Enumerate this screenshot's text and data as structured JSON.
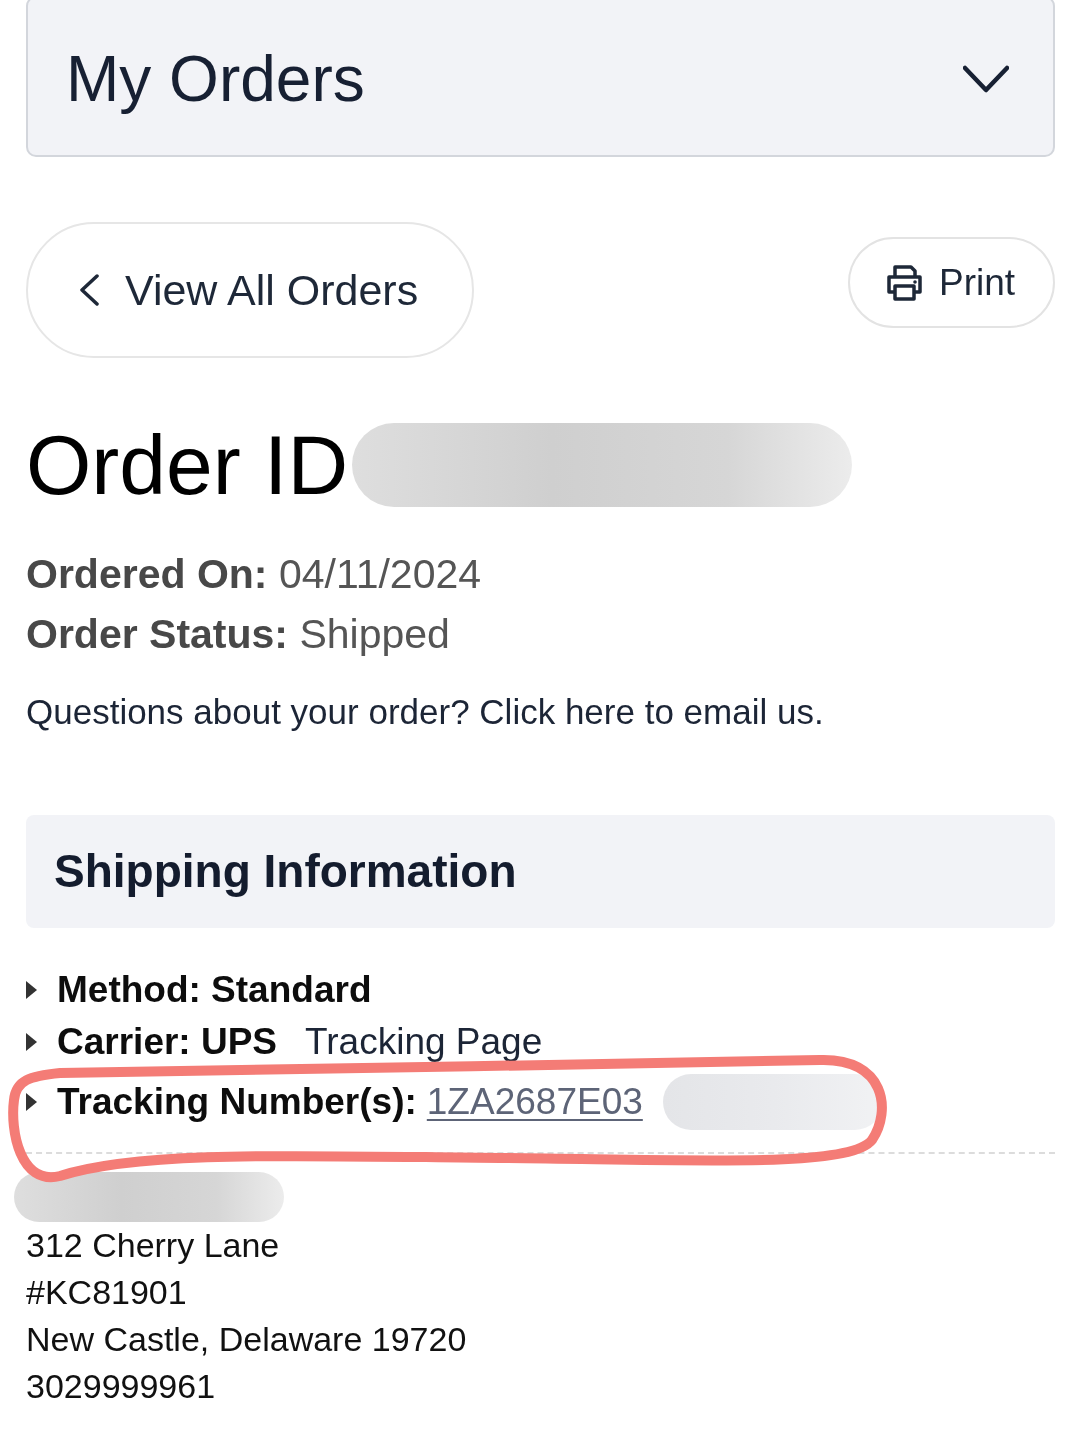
{
  "header_dropdown": {
    "label": "My Orders",
    "expanded": false
  },
  "actions": {
    "back": "View All Orders",
    "print": "Print"
  },
  "order": {
    "title": "Order ID",
    "details": [
      {
        "label": "Ordered On:",
        "value": "04/11/2024"
      },
      {
        "label": "Order Status:",
        "value": "Shipped"
      }
    ],
    "contact": "Questions about your order? Click here to email us."
  },
  "shipping": {
    "title": "Shipping Information",
    "items": [
      {
        "kind": "text",
        "text": "Method: Standard"
      },
      {
        "kind": "link",
        "text": "Carrier: UPS",
        "link": "Tracking Page"
      },
      {
        "kind": "tracking",
        "text": "Tracking Number(s):",
        "link": "1ZA2687E03"
      }
    ],
    "address": [
      "312 Cherry Lane",
      "#KC81901",
      "New Castle, Delaware 19720",
      "3029999961"
    ]
  }
}
